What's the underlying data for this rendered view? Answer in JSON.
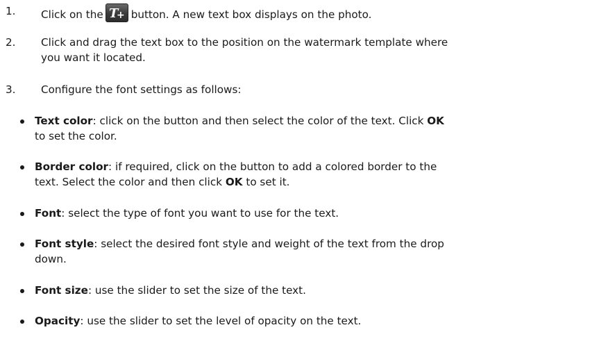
{
  "steps": [
    {
      "number": "1.",
      "before_button": "Click on the",
      "button_icon": "text-add-icon",
      "after_button": "button. A new text box displays on the photo."
    },
    {
      "number": "2.",
      "line1": "Click and drag the text box to the position on the watermark template where",
      "line2": "you want it located."
    },
    {
      "number": "3.",
      "text": "Configure the font settings as follows:"
    }
  ],
  "bullets": [
    {
      "term": "Text color",
      "line1": ": click on the button and then select the color of the text. Click ",
      "bold_ok": "OK",
      "line2": "to set the color."
    },
    {
      "term": "Border color",
      "line1": ": if required, click on the button to add a colored border to the",
      "line2a": "text. Select the color and then click ",
      "bold_ok": "OK",
      "line2b": " to set it."
    },
    {
      "term": "Font",
      "text": ": select the type of font you want to use for the text."
    },
    {
      "term": "Font style",
      "line1": ": select the desired font style and weight of the text from the drop",
      "line2": "down."
    },
    {
      "term": "Font size",
      "text": ": use the slider to set the size of the text."
    },
    {
      "term": "Opacity",
      "text": ": use the slider to set the level of opacity on the text."
    }
  ]
}
